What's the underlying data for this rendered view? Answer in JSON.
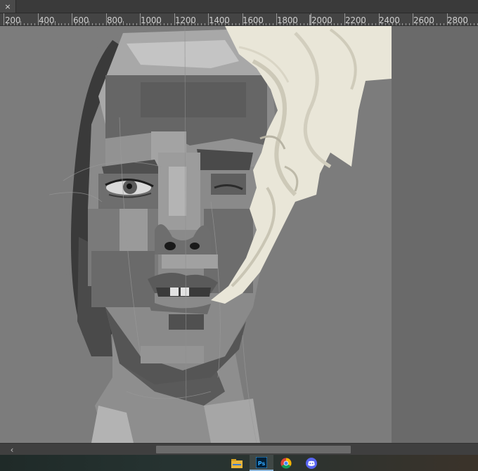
{
  "tabbar": {
    "close_glyph": "×"
  },
  "ruler": {
    "labels": [
      "200",
      "400",
      "600",
      "800",
      "1000",
      "1200",
      "1400",
      "1600",
      "1800",
      "2000",
      "2200",
      "2400",
      "2600",
      "2800"
    ]
  },
  "scrollbar": {
    "left_arrow": "‹"
  },
  "taskbar": {
    "apps": [
      {
        "name": "file-explorer-icon"
      },
      {
        "name": "photoshop-icon",
        "label": "Ps",
        "active": true
      },
      {
        "name": "chrome-icon"
      },
      {
        "name": "discord-icon"
      }
    ]
  },
  "colors": {
    "canvas_bg": "#7c7c7c",
    "smoke": "#ece9dc",
    "workspace": "#6a6a6a"
  }
}
